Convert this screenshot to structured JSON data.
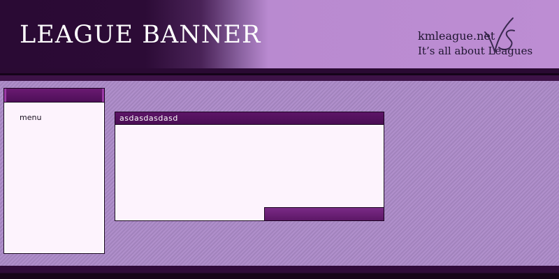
{
  "header": {
    "banner_title": "LEAGUE BANNER",
    "site_name": "kmleague.net",
    "tagline": "It’s all about Leagues",
    "logo_mark": "vs-logo-icon"
  },
  "menu_panel": {
    "label": "menu"
  },
  "content_panel": {
    "title": "asdasdasdasd"
  },
  "colors": {
    "header_dark": "#2c0b36",
    "header_light": "#bd8dd3",
    "panel_header": "#4e0f58",
    "panel_body": "#fdf3fd",
    "page_background": "#a988c4"
  }
}
